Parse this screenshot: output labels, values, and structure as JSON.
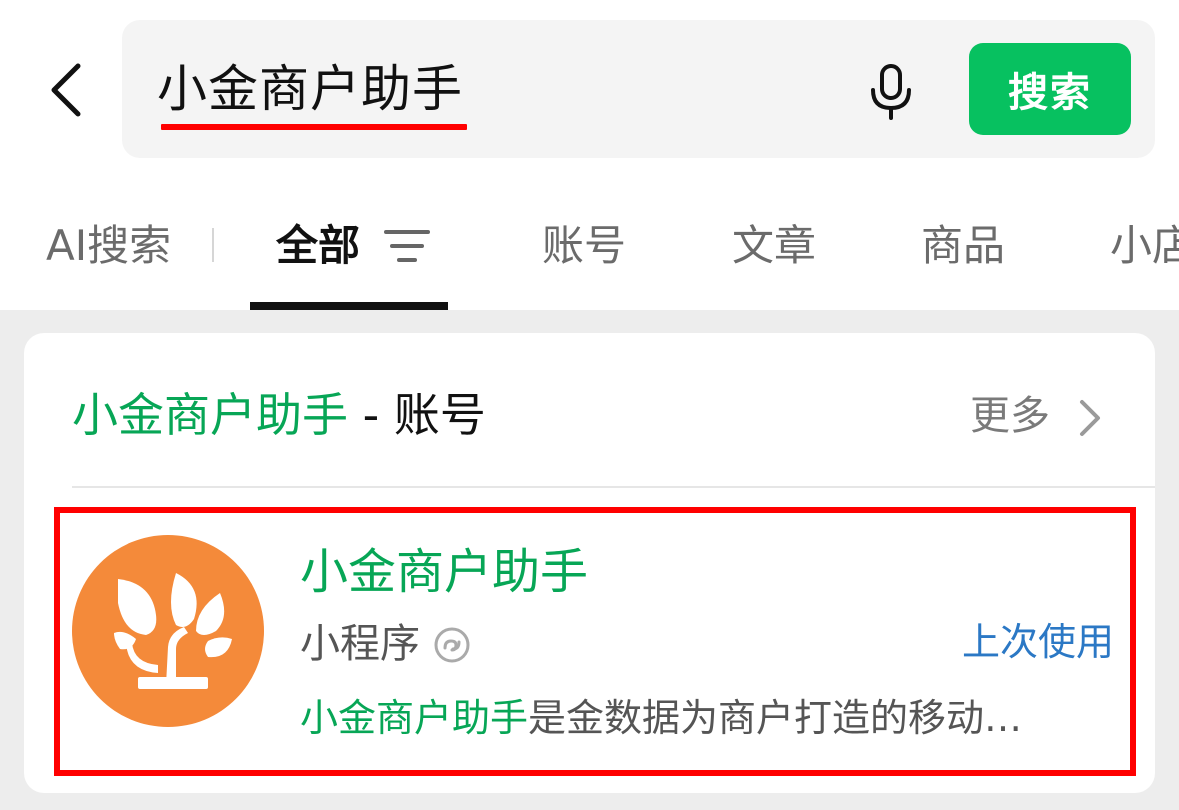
{
  "search": {
    "query": "小金商户助手",
    "button_label": "搜索"
  },
  "tabs": [
    {
      "label": "AI搜索"
    },
    {
      "label": "全部"
    },
    {
      "label": "账号"
    },
    {
      "label": "文章"
    },
    {
      "label": "商品"
    },
    {
      "label": "小店"
    }
  ],
  "section": {
    "keyword": "小金商户助手",
    "separator": " - ",
    "category": "账号",
    "more_label": "更多"
  },
  "result": {
    "name": "小金商户助手",
    "type": "小程序",
    "recent_label": "上次使用",
    "desc_keyword": "小金商户助手",
    "desc_rest": "是金数据为商户打造的移动…"
  },
  "colors": {
    "accent_green": "#07c160",
    "highlight_green": "#07a656",
    "annotation_red": "#ff0000",
    "link_blue": "#2b78c5",
    "logo_orange": "#f48a3a"
  },
  "icons": {
    "back": "chevron-left-icon",
    "mic": "microphone-icon",
    "filter": "filter-icon",
    "more": "chevron-right-icon",
    "mini_program": "mini-program-icon",
    "logo": "tree-leaves-logo"
  }
}
